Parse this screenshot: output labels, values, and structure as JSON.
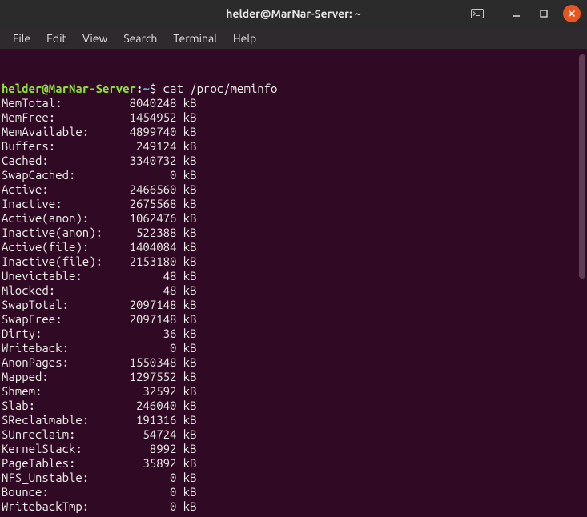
{
  "window": {
    "title": "helder@MarNar-Server: ~"
  },
  "menubar": {
    "items": [
      "File",
      "Edit",
      "View",
      "Search",
      "Terminal",
      "Help"
    ]
  },
  "prompt": {
    "user_host": "helder@MarNar-Server",
    "colon": ":",
    "path": "~",
    "symbol": "$",
    "command": "cat /proc/meminfo"
  },
  "meminfo": [
    {
      "key": "MemTotal:",
      "value": "8040248",
      "unit": "kB"
    },
    {
      "key": "MemFree:",
      "value": "1454952",
      "unit": "kB"
    },
    {
      "key": "MemAvailable:",
      "value": "4899740",
      "unit": "kB"
    },
    {
      "key": "Buffers:",
      "value": "249124",
      "unit": "kB"
    },
    {
      "key": "Cached:",
      "value": "3340732",
      "unit": "kB"
    },
    {
      "key": "SwapCached:",
      "value": "0",
      "unit": "kB"
    },
    {
      "key": "Active:",
      "value": "2466560",
      "unit": "kB"
    },
    {
      "key": "Inactive:",
      "value": "2675568",
      "unit": "kB"
    },
    {
      "key": "Active(anon):",
      "value": "1062476",
      "unit": "kB"
    },
    {
      "key": "Inactive(anon):",
      "value": "522388",
      "unit": "kB"
    },
    {
      "key": "Active(file):",
      "value": "1404084",
      "unit": "kB"
    },
    {
      "key": "Inactive(file):",
      "value": "2153180",
      "unit": "kB"
    },
    {
      "key": "Unevictable:",
      "value": "48",
      "unit": "kB"
    },
    {
      "key": "Mlocked:",
      "value": "48",
      "unit": "kB"
    },
    {
      "key": "SwapTotal:",
      "value": "2097148",
      "unit": "kB"
    },
    {
      "key": "SwapFree:",
      "value": "2097148",
      "unit": "kB"
    },
    {
      "key": "Dirty:",
      "value": "36",
      "unit": "kB"
    },
    {
      "key": "Writeback:",
      "value": "0",
      "unit": "kB"
    },
    {
      "key": "AnonPages:",
      "value": "1550348",
      "unit": "kB"
    },
    {
      "key": "Mapped:",
      "value": "1297552",
      "unit": "kB"
    },
    {
      "key": "Shmem:",
      "value": "32592",
      "unit": "kB"
    },
    {
      "key": "Slab:",
      "value": "246040",
      "unit": "kB"
    },
    {
      "key": "SReclaimable:",
      "value": "191316",
      "unit": "kB"
    },
    {
      "key": "SUnreclaim:",
      "value": "54724",
      "unit": "kB"
    },
    {
      "key": "KernelStack:",
      "value": "8992",
      "unit": "kB"
    },
    {
      "key": "PageTables:",
      "value": "35892",
      "unit": "kB"
    },
    {
      "key": "NFS_Unstable:",
      "value": "0",
      "unit": "kB"
    },
    {
      "key": "Bounce:",
      "value": "0",
      "unit": "kB"
    },
    {
      "key": "WritebackTmp:",
      "value": "0",
      "unit": "kB"
    }
  ],
  "layout": {
    "key_width": 16,
    "value_width": 10
  }
}
